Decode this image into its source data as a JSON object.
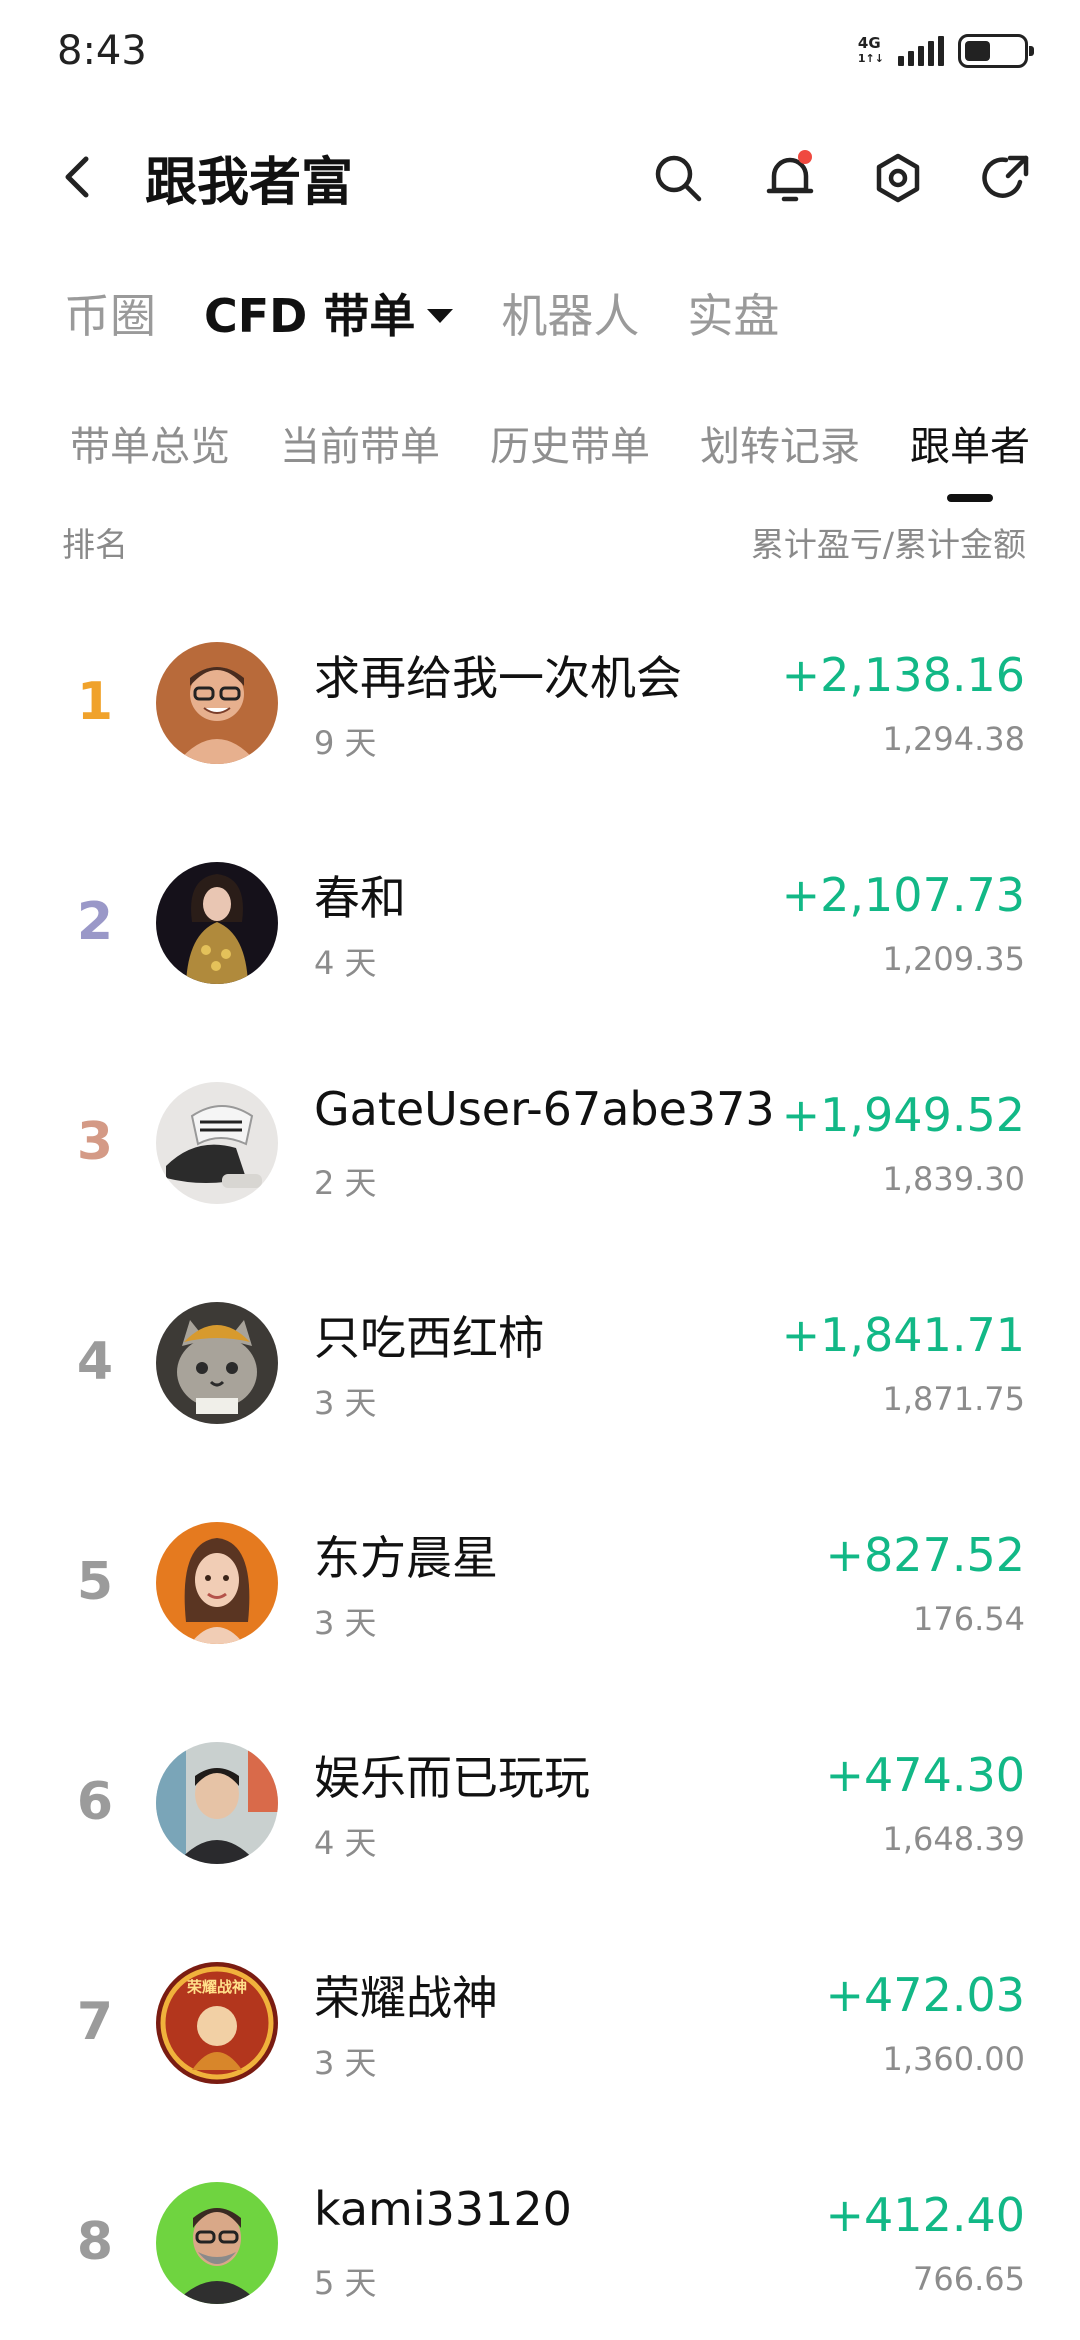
{
  "status_bar": {
    "time": "8:43",
    "network": "4G",
    "network_sub": "1↑↓",
    "battery_level": 0.45
  },
  "header": {
    "title": "跟我者富",
    "icons": [
      "back-icon",
      "search-icon",
      "bell-icon",
      "settings-icon",
      "share-icon"
    ],
    "notification_dot_color": "#f0493f"
  },
  "main_tabs": [
    {
      "label": "币圈",
      "active": false
    },
    {
      "label": "CFD 带单",
      "active": true
    },
    {
      "label": "机器人",
      "active": false
    },
    {
      "label": "实盘",
      "active": false
    }
  ],
  "sub_tabs": [
    {
      "label": "带单总览",
      "active": false
    },
    {
      "label": "当前带单",
      "active": false
    },
    {
      "label": "历史带单",
      "active": false
    },
    {
      "label": "划转记录",
      "active": false
    },
    {
      "label": "跟单者",
      "active": true
    }
  ],
  "list_header": {
    "left": "排名",
    "right": "累计盈亏/累计金额"
  },
  "colors": {
    "profit_green": "#12b886",
    "rank1": "#f0a22b",
    "rank2": "#9a98c8",
    "rank3": "#d49a86",
    "rank_default": "#9b9b9b"
  },
  "rows": [
    {
      "rank": "1",
      "name": "求再给我一次机会",
      "days": "9 天",
      "pnl": "+2,138.16",
      "amount": "1,294.38",
      "avatar": "avatar-man-glasses"
    },
    {
      "rank": "2",
      "name": "春和",
      "days": "4 天",
      "pnl": "+2,107.73",
      "amount": "1,209.35",
      "avatar": "avatar-woman-gold"
    },
    {
      "rank": "3",
      "name": "GateUser-67abe373",
      "days": "2 天",
      "pnl": "+1,949.52",
      "amount": "1,839.30",
      "avatar": "avatar-sneakers"
    },
    {
      "rank": "4",
      "name": "只吃西红柿",
      "days": "3 天",
      "pnl": "+1,841.71",
      "amount": "1,871.75",
      "avatar": "avatar-cat"
    },
    {
      "rank": "5",
      "name": "东方晨星",
      "days": "3 天",
      "pnl": "+827.52",
      "amount": "176.54",
      "avatar": "avatar-woman-orange"
    },
    {
      "rank": "6",
      "name": "娱乐而已玩玩",
      "days": "4 天",
      "pnl": "+474.30",
      "amount": "1,648.39",
      "avatar": "avatar-man-room"
    },
    {
      "rank": "7",
      "name": "荣耀战神",
      "days": "3 天",
      "pnl": "+472.03",
      "amount": "1,360.00",
      "avatar": "avatar-warrior-badge",
      "avatar_text": "荣耀战神"
    },
    {
      "rank": "8",
      "name": "kami33120",
      "days": "5 天",
      "pnl": "+412.40",
      "amount": "766.65",
      "avatar": "avatar-man-green"
    }
  ]
}
